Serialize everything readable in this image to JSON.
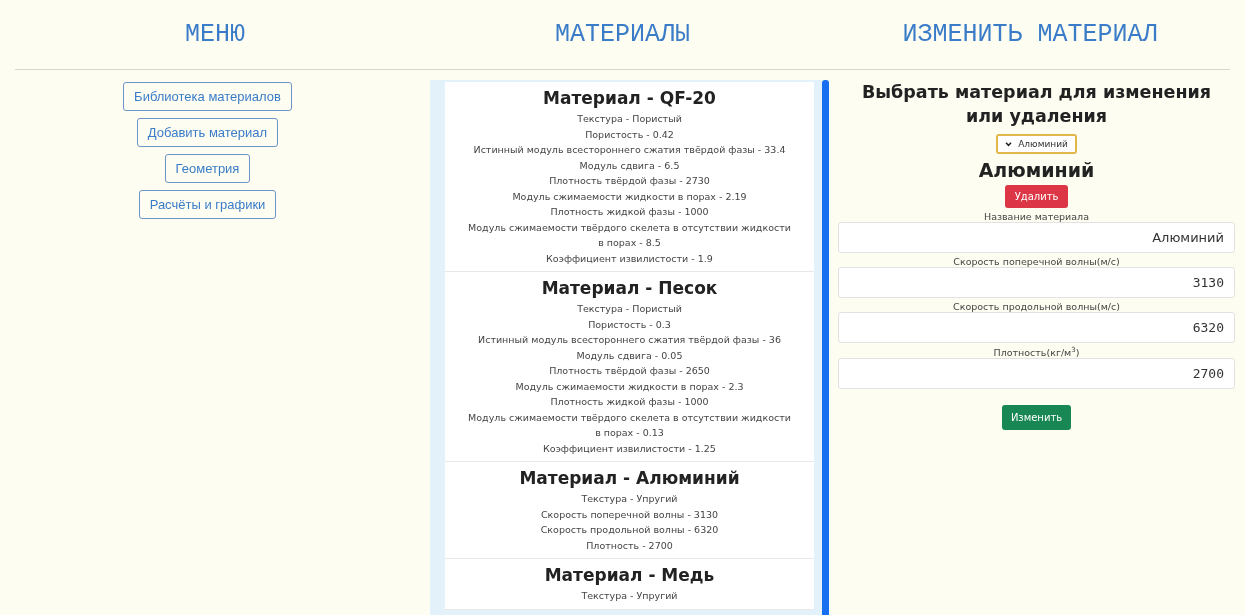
{
  "columns": [
    {
      "heading": "МЕНЮ"
    },
    {
      "heading": "МАТЕРИАЛЫ"
    },
    {
      "heading": "ИЗМЕНИТЬ МАТЕРИАЛ"
    }
  ],
  "menu": [
    "Библиотека материалов",
    "Добавить материал",
    "Геометрия",
    "Расчёты и графики"
  ],
  "materials": [
    {
      "title": "Материал - QF-20",
      "lines": [
        "Текстура - Пористый",
        "Пористость - 0.42",
        "Истинный модуль всестороннего сжатия твёрдой фазы - 33.4",
        "Модуль сдвига - 6.5",
        "Плотность твёрдой фазы - 2730",
        "Модуль сжимаемости жидкости в порах - 2.19",
        "Плотность жидкой фазы - 1000",
        "Модуль сжимаемости твёрдого скелета в отсутствии жидкости в порах - 8.5",
        "Коэффициент извилистости - 1.9"
      ]
    },
    {
      "title": "Материал - Песок",
      "lines": [
        "Текстура - Пористый",
        "Пористость - 0.3",
        "Истинный модуль всестороннего сжатия твёрдой фазы - 36",
        "Модуль сдвига - 0.05",
        "Плотность твёрдой фазы - 2650",
        "Модуль сжимаемости жидкости в порах - 2.3",
        "Плотность жидкой фазы - 1000",
        "Модуль сжимаемости твёрдого скелета в отсутствии жидкости в порах - 0.13",
        "Коэффициент извилистости - 1.25"
      ]
    },
    {
      "title": "Материал - Алюминий",
      "lines": [
        "Текстура - Упругий",
        "Скорость поперечной волны - 3130",
        "Скорость продольной волны - 6320",
        "Плотность - 2700"
      ]
    },
    {
      "title": "Материал - Медь",
      "lines": [
        "Текстура - Упругий"
      ]
    }
  ],
  "editor": {
    "title": "Выбрать материал для изменения или удаления",
    "select": {
      "value": "Алюминий"
    },
    "material_name": "Алюминий",
    "delete_button": "Удалить",
    "fields": [
      {
        "label": "Название материала",
        "value": "Алюминий",
        "kind": "text"
      },
      {
        "label": "Скорость поперечной волны(м/с)",
        "value": "3130",
        "kind": "number"
      },
      {
        "label": "Скорость продольной волны(м/с)",
        "value": "6320",
        "kind": "number"
      },
      {
        "label": "Плотность(кг/м$^{3}$)",
        "value": "2700",
        "kind": "number"
      }
    ],
    "submit_button": "Изменить"
  }
}
